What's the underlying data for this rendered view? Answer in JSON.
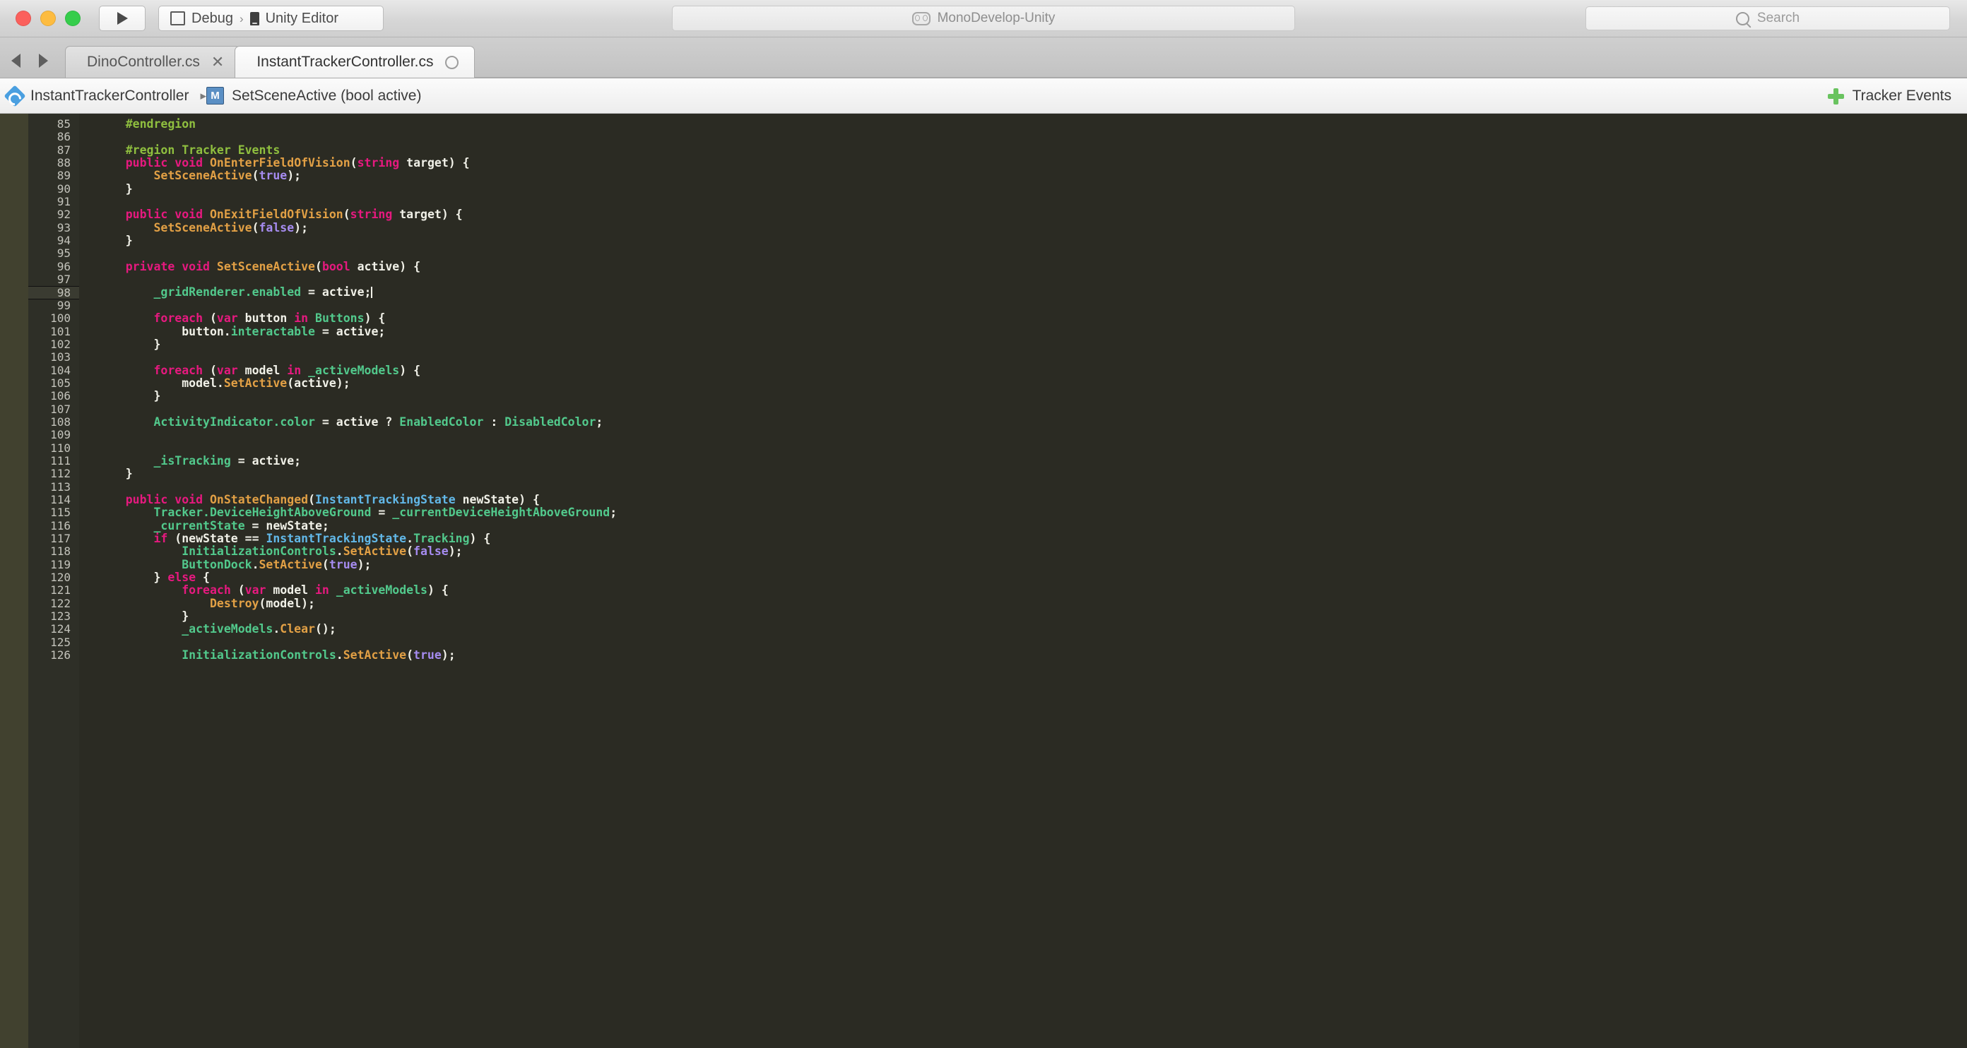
{
  "window": {
    "traffic_lights": [
      "close",
      "minimize",
      "zoom"
    ],
    "run_button_icon": "play-icon",
    "target_configuration": "Debug",
    "target_device": "Unity Editor",
    "status_text": "MonoDevelop-Unity",
    "status_icon": "mono-logo-icon",
    "search_placeholder": "Search",
    "search_value": ""
  },
  "tabs": {
    "nav_back_icon": "arrow-left-icon",
    "nav_forward_icon": "arrow-right-icon",
    "items": [
      {
        "label": "DinoController.cs",
        "active": false,
        "close_glyph": "✕",
        "modified": false
      },
      {
        "label": "InstantTrackerController.cs",
        "active": true,
        "close_glyph": "",
        "modified": true
      }
    ]
  },
  "breadcrumb": {
    "class_icon": "class-icon",
    "class_name": "InstantTrackerController",
    "separator": "▸",
    "method_icon": "method-icon",
    "method_icon_letter": "M",
    "method_name": "SetSceneActive (bool active)",
    "right_icon": "plus-icon",
    "right_label": "Tracker Events"
  },
  "editor": {
    "current_line": 98,
    "first_line": 85,
    "colors": {
      "background": "#2b2b23",
      "gutter_background": "#2e2f27",
      "fold_strip": "#41412f",
      "text": "#f1f1e8",
      "keyword": "#e6197f",
      "preprocessor": "#8fbf3f",
      "type": "#62b8e8",
      "function": "#e2a045",
      "identifier": "#52c98c",
      "literal": "#a68cf0",
      "line_number": "#c3c3bb"
    },
    "lines": [
      {
        "n": 85,
        "tokens": [
          {
            "t": "    ",
            "c": "plain"
          },
          {
            "t": "#endregion",
            "c": "pre"
          }
        ]
      },
      {
        "n": 86,
        "tokens": []
      },
      {
        "n": 87,
        "tokens": [
          {
            "t": "    ",
            "c": "plain"
          },
          {
            "t": "#region Tracker Events",
            "c": "pre"
          }
        ]
      },
      {
        "n": 88,
        "tokens": [
          {
            "t": "    ",
            "c": "plain"
          },
          {
            "t": "public",
            "c": "kw"
          },
          {
            "t": " ",
            "c": "plain"
          },
          {
            "t": "void",
            "c": "kw"
          },
          {
            "t": " ",
            "c": "plain"
          },
          {
            "t": "OnEnterFieldOfVision",
            "c": "func"
          },
          {
            "t": "(",
            "c": "plain"
          },
          {
            "t": "string",
            "c": "kw"
          },
          {
            "t": " target) {",
            "c": "plain"
          }
        ]
      },
      {
        "n": 89,
        "tokens": [
          {
            "t": "        ",
            "c": "plain"
          },
          {
            "t": "SetSceneActive",
            "c": "func"
          },
          {
            "t": "(",
            "c": "plain"
          },
          {
            "t": "true",
            "c": "lit"
          },
          {
            "t": ");",
            "c": "plain"
          }
        ]
      },
      {
        "n": 90,
        "tokens": [
          {
            "t": "    }",
            "c": "plain"
          }
        ]
      },
      {
        "n": 91,
        "tokens": []
      },
      {
        "n": 92,
        "tokens": [
          {
            "t": "    ",
            "c": "plain"
          },
          {
            "t": "public",
            "c": "kw"
          },
          {
            "t": " ",
            "c": "plain"
          },
          {
            "t": "void",
            "c": "kw"
          },
          {
            "t": " ",
            "c": "plain"
          },
          {
            "t": "OnExitFieldOfVision",
            "c": "func"
          },
          {
            "t": "(",
            "c": "plain"
          },
          {
            "t": "string",
            "c": "kw"
          },
          {
            "t": " target) {",
            "c": "plain"
          }
        ]
      },
      {
        "n": 93,
        "tokens": [
          {
            "t": "        ",
            "c": "plain"
          },
          {
            "t": "SetSceneActive",
            "c": "func"
          },
          {
            "t": "(",
            "c": "plain"
          },
          {
            "t": "false",
            "c": "lit"
          },
          {
            "t": ");",
            "c": "plain"
          }
        ]
      },
      {
        "n": 94,
        "tokens": [
          {
            "t": "    }",
            "c": "plain"
          }
        ]
      },
      {
        "n": 95,
        "tokens": []
      },
      {
        "n": 96,
        "tokens": [
          {
            "t": "    ",
            "c": "plain"
          },
          {
            "t": "private",
            "c": "kw"
          },
          {
            "t": " ",
            "c": "plain"
          },
          {
            "t": "void",
            "c": "kw"
          },
          {
            "t": " ",
            "c": "plain"
          },
          {
            "t": "SetSceneActive",
            "c": "func"
          },
          {
            "t": "(",
            "c": "plain"
          },
          {
            "t": "bool",
            "c": "kw"
          },
          {
            "t": " active) {",
            "c": "plain"
          }
        ]
      },
      {
        "n": 97,
        "tokens": []
      },
      {
        "n": 98,
        "tokens": [
          {
            "t": "        ",
            "c": "plain"
          },
          {
            "t": "_gridRenderer",
            "c": "ident"
          },
          {
            "t": ".",
            "c": "ident"
          },
          {
            "t": "enabled",
            "c": "ident"
          },
          {
            "t": " = active;",
            "c": "plain"
          }
        ],
        "caret_after": true
      },
      {
        "n": 99,
        "tokens": []
      },
      {
        "n": 100,
        "tokens": [
          {
            "t": "        ",
            "c": "plain"
          },
          {
            "t": "foreach",
            "c": "kw"
          },
          {
            "t": " (",
            "c": "plain"
          },
          {
            "t": "var",
            "c": "kw"
          },
          {
            "t": " button ",
            "c": "plain"
          },
          {
            "t": "in",
            "c": "kw"
          },
          {
            "t": " ",
            "c": "plain"
          },
          {
            "t": "Buttons",
            "c": "ident"
          },
          {
            "t": ") {",
            "c": "plain"
          }
        ]
      },
      {
        "n": 101,
        "tokens": [
          {
            "t": "            button.",
            "c": "plain"
          },
          {
            "t": "interactable",
            "c": "ident"
          },
          {
            "t": " = active;",
            "c": "plain"
          }
        ]
      },
      {
        "n": 102,
        "tokens": [
          {
            "t": "        }",
            "c": "plain"
          }
        ]
      },
      {
        "n": 103,
        "tokens": []
      },
      {
        "n": 104,
        "tokens": [
          {
            "t": "        ",
            "c": "plain"
          },
          {
            "t": "foreach",
            "c": "kw"
          },
          {
            "t": " (",
            "c": "plain"
          },
          {
            "t": "var",
            "c": "kw"
          },
          {
            "t": " model ",
            "c": "plain"
          },
          {
            "t": "in",
            "c": "kw"
          },
          {
            "t": " ",
            "c": "plain"
          },
          {
            "t": "_activeModels",
            "c": "ident"
          },
          {
            "t": ") {",
            "c": "plain"
          }
        ]
      },
      {
        "n": 105,
        "tokens": [
          {
            "t": "            model.",
            "c": "plain"
          },
          {
            "t": "SetActive",
            "c": "func"
          },
          {
            "t": "(active);",
            "c": "plain"
          }
        ]
      },
      {
        "n": 106,
        "tokens": [
          {
            "t": "        }",
            "c": "plain"
          }
        ]
      },
      {
        "n": 107,
        "tokens": []
      },
      {
        "n": 108,
        "tokens": [
          {
            "t": "        ",
            "c": "plain"
          },
          {
            "t": "ActivityIndicator",
            "c": "ident"
          },
          {
            "t": ".",
            "c": "ident"
          },
          {
            "t": "color",
            "c": "ident"
          },
          {
            "t": " = active ? ",
            "c": "plain"
          },
          {
            "t": "EnabledColor",
            "c": "ident"
          },
          {
            "t": " : ",
            "c": "plain"
          },
          {
            "t": "DisabledColor",
            "c": "ident"
          },
          {
            "t": ";",
            "c": "plain"
          }
        ]
      },
      {
        "n": 109,
        "tokens": []
      },
      {
        "n": 110,
        "tokens": []
      },
      {
        "n": 111,
        "tokens": [
          {
            "t": "        ",
            "c": "plain"
          },
          {
            "t": "_isTracking",
            "c": "ident"
          },
          {
            "t": " = active;",
            "c": "plain"
          }
        ]
      },
      {
        "n": 112,
        "tokens": [
          {
            "t": "    }",
            "c": "plain"
          }
        ]
      },
      {
        "n": 113,
        "tokens": []
      },
      {
        "n": 114,
        "tokens": [
          {
            "t": "    ",
            "c": "plain"
          },
          {
            "t": "public",
            "c": "kw"
          },
          {
            "t": " ",
            "c": "plain"
          },
          {
            "t": "void",
            "c": "kw"
          },
          {
            "t": " ",
            "c": "plain"
          },
          {
            "t": "OnStateChanged",
            "c": "func"
          },
          {
            "t": "(",
            "c": "plain"
          },
          {
            "t": "InstantTrackingState",
            "c": "type"
          },
          {
            "t": " newState) {",
            "c": "plain"
          }
        ]
      },
      {
        "n": 115,
        "tokens": [
          {
            "t": "        ",
            "c": "plain"
          },
          {
            "t": "Tracker",
            "c": "ident"
          },
          {
            "t": ".",
            "c": "ident"
          },
          {
            "t": "DeviceHeightAboveGround",
            "c": "ident"
          },
          {
            "t": " = ",
            "c": "plain"
          },
          {
            "t": "_currentDeviceHeightAboveGround",
            "c": "ident"
          },
          {
            "t": ";",
            "c": "plain"
          }
        ]
      },
      {
        "n": 116,
        "tokens": [
          {
            "t": "        ",
            "c": "plain"
          },
          {
            "t": "_currentState",
            "c": "ident"
          },
          {
            "t": " = newState;",
            "c": "plain"
          }
        ]
      },
      {
        "n": 117,
        "tokens": [
          {
            "t": "        ",
            "c": "plain"
          },
          {
            "t": "if",
            "c": "kw"
          },
          {
            "t": " (newState == ",
            "c": "plain"
          },
          {
            "t": "InstantTrackingState",
            "c": "type"
          },
          {
            "t": ".",
            "c": "plain"
          },
          {
            "t": "Tracking",
            "c": "ident"
          },
          {
            "t": ") {",
            "c": "plain"
          }
        ]
      },
      {
        "n": 118,
        "tokens": [
          {
            "t": "            ",
            "c": "plain"
          },
          {
            "t": "InitializationControls",
            "c": "ident"
          },
          {
            "t": ".",
            "c": "plain"
          },
          {
            "t": "SetActive",
            "c": "func"
          },
          {
            "t": "(",
            "c": "plain"
          },
          {
            "t": "false",
            "c": "lit"
          },
          {
            "t": ");",
            "c": "plain"
          }
        ]
      },
      {
        "n": 119,
        "tokens": [
          {
            "t": "            ",
            "c": "plain"
          },
          {
            "t": "ButtonDock",
            "c": "ident"
          },
          {
            "t": ".",
            "c": "plain"
          },
          {
            "t": "SetActive",
            "c": "func"
          },
          {
            "t": "(",
            "c": "plain"
          },
          {
            "t": "true",
            "c": "lit"
          },
          {
            "t": ");",
            "c": "plain"
          }
        ]
      },
      {
        "n": 120,
        "tokens": [
          {
            "t": "        } ",
            "c": "plain"
          },
          {
            "t": "else",
            "c": "kw"
          },
          {
            "t": " {",
            "c": "plain"
          }
        ]
      },
      {
        "n": 121,
        "tokens": [
          {
            "t": "            ",
            "c": "plain"
          },
          {
            "t": "foreach",
            "c": "kw"
          },
          {
            "t": " (",
            "c": "plain"
          },
          {
            "t": "var",
            "c": "kw"
          },
          {
            "t": " model ",
            "c": "plain"
          },
          {
            "t": "in",
            "c": "kw"
          },
          {
            "t": " ",
            "c": "plain"
          },
          {
            "t": "_activeModels",
            "c": "ident"
          },
          {
            "t": ") {",
            "c": "plain"
          }
        ]
      },
      {
        "n": 122,
        "tokens": [
          {
            "t": "                ",
            "c": "plain"
          },
          {
            "t": "Destroy",
            "c": "func"
          },
          {
            "t": "(model);",
            "c": "plain"
          }
        ]
      },
      {
        "n": 123,
        "tokens": [
          {
            "t": "            }",
            "c": "plain"
          }
        ]
      },
      {
        "n": 124,
        "tokens": [
          {
            "t": "            ",
            "c": "plain"
          },
          {
            "t": "_activeModels",
            "c": "ident"
          },
          {
            "t": ".",
            "c": "plain"
          },
          {
            "t": "Clear",
            "c": "func"
          },
          {
            "t": "();",
            "c": "plain"
          }
        ]
      },
      {
        "n": 125,
        "tokens": []
      },
      {
        "n": 126,
        "tokens": [
          {
            "t": "            ",
            "c": "plain"
          },
          {
            "t": "InitializationControls",
            "c": "ident"
          },
          {
            "t": ".",
            "c": "plain"
          },
          {
            "t": "SetActive",
            "c": "func"
          },
          {
            "t": "(",
            "c": "plain"
          },
          {
            "t": "true",
            "c": "lit"
          },
          {
            "t": ");",
            "c": "plain"
          }
        ]
      }
    ]
  }
}
